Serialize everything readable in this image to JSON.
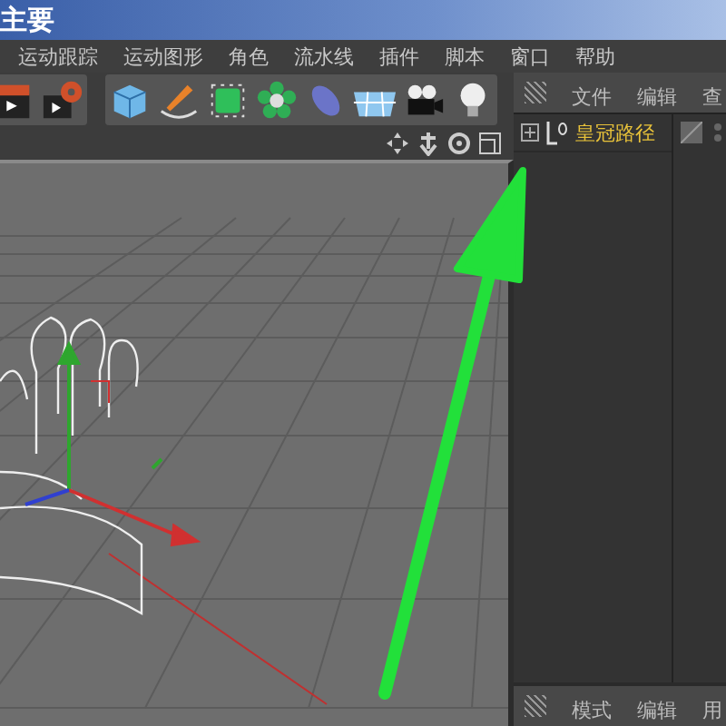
{
  "window": {
    "title": "主要"
  },
  "menu": [
    {
      "label": "运动跟踪"
    },
    {
      "label": "运动图形"
    },
    {
      "label": "角色"
    },
    {
      "label": "流水线"
    },
    {
      "label": "插件"
    },
    {
      "label": "脚本"
    },
    {
      "label": "窗口"
    },
    {
      "label": "帮助"
    }
  ],
  "objects_panel": {
    "tabs": [
      "文件",
      "编辑",
      "查"
    ],
    "objects": [
      {
        "name": "皇冠路径",
        "expanded": false
      }
    ]
  },
  "attributes_panel": {
    "tabs": [
      "模式",
      "编辑",
      "用"
    ]
  }
}
